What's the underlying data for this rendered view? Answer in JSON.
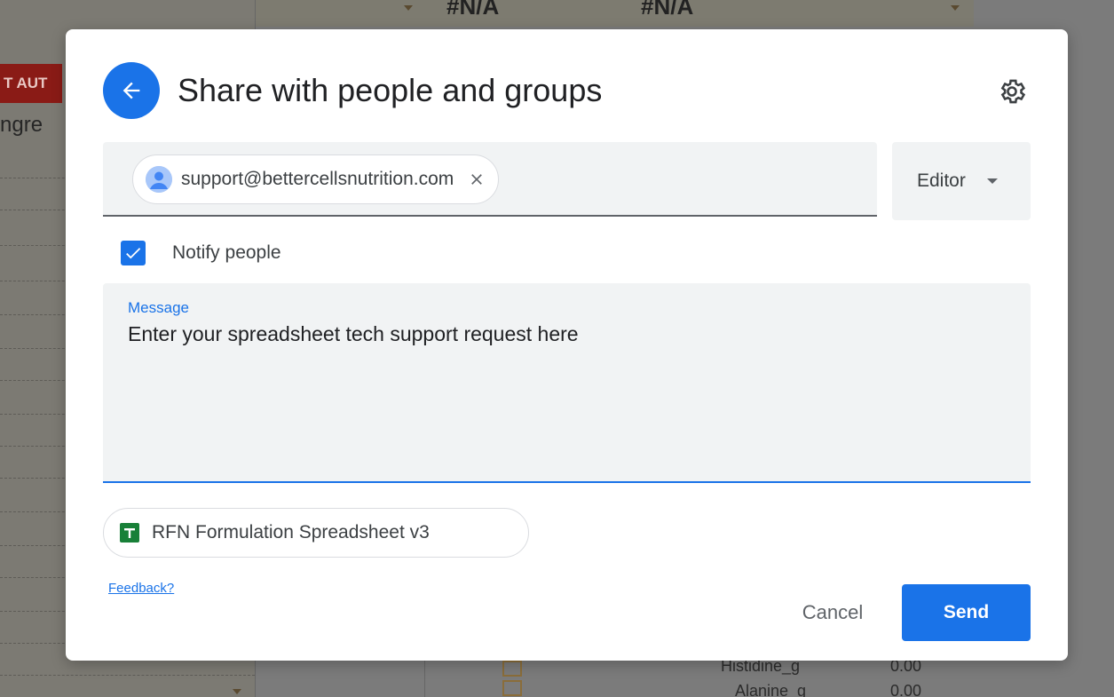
{
  "background": {
    "cells_na_1": "#N/A",
    "cells_na_2": "#N/A",
    "banner_text": "T AUT",
    "column_header": "ngre",
    "row_label_1": "Histidine_g",
    "row_value_1": "0.00",
    "row_label_2": "Alanine_g",
    "row_value_2": "0.00"
  },
  "dialog": {
    "title": "Share with people and groups",
    "back_icon": "arrow-left-icon",
    "settings_icon": "gear-icon",
    "recipient": {
      "email": "support@bettercellsnutrition.com",
      "avatar_icon": "person-avatar-icon",
      "remove_icon": "close-icon"
    },
    "role": {
      "selected": "Editor",
      "caret_icon": "caret-down-icon"
    },
    "notify": {
      "label": "Notify people",
      "checked": true
    },
    "message": {
      "label": "Message",
      "value": "Enter your spreadsheet tech support request here"
    },
    "file": {
      "name": "RFN Formulation Spreadsheet v3",
      "icon": "google-sheets-icon"
    },
    "feedback_link": "Feedback?",
    "cancel_label": "Cancel",
    "send_label": "Send"
  },
  "colors": {
    "accent": "#1a73e8",
    "field_bg": "#f1f3f4",
    "sheets_green": "#188038",
    "overlay": "#7b7b7b"
  }
}
